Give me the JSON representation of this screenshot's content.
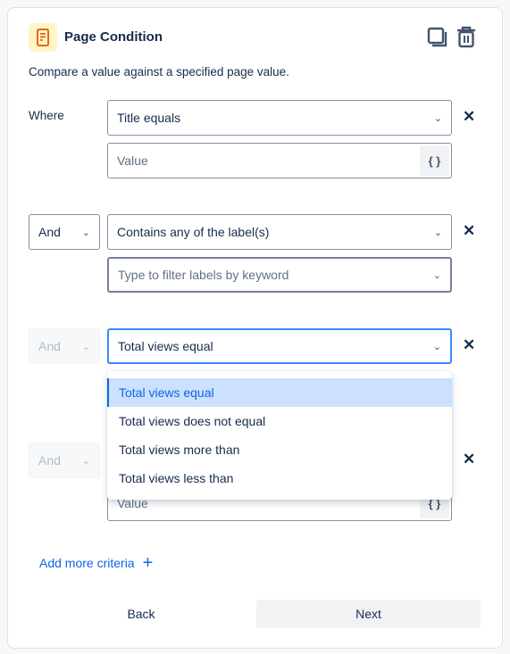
{
  "header": {
    "title": "Page Condition",
    "description": "Compare a value against a specified page value.",
    "icon": "page-document-icon",
    "accent": "#e56910"
  },
  "rows": [
    {
      "label": "Where",
      "condition": "Title equals",
      "value_placeholder": "Value",
      "braces": "{ }"
    },
    {
      "operator": "And",
      "condition": "Contains any of the label(s)",
      "filter_placeholder": "Type to filter labels by keyword"
    },
    {
      "operator": "And",
      "condition": "Total views equal",
      "disabled_operator": true
    },
    {
      "operator": "And",
      "value_placeholder": "Value",
      "braces": "{ }",
      "disabled_operator": true
    }
  ],
  "dropdown": {
    "options": [
      "Total views equal",
      "Total views does not equal",
      "Total views more than",
      "Total views less than"
    ],
    "selected": "Total views equal"
  },
  "add_more": "Add more criteria",
  "footer": {
    "back": "Back",
    "next": "Next"
  },
  "accent_color": "#0c66e4"
}
